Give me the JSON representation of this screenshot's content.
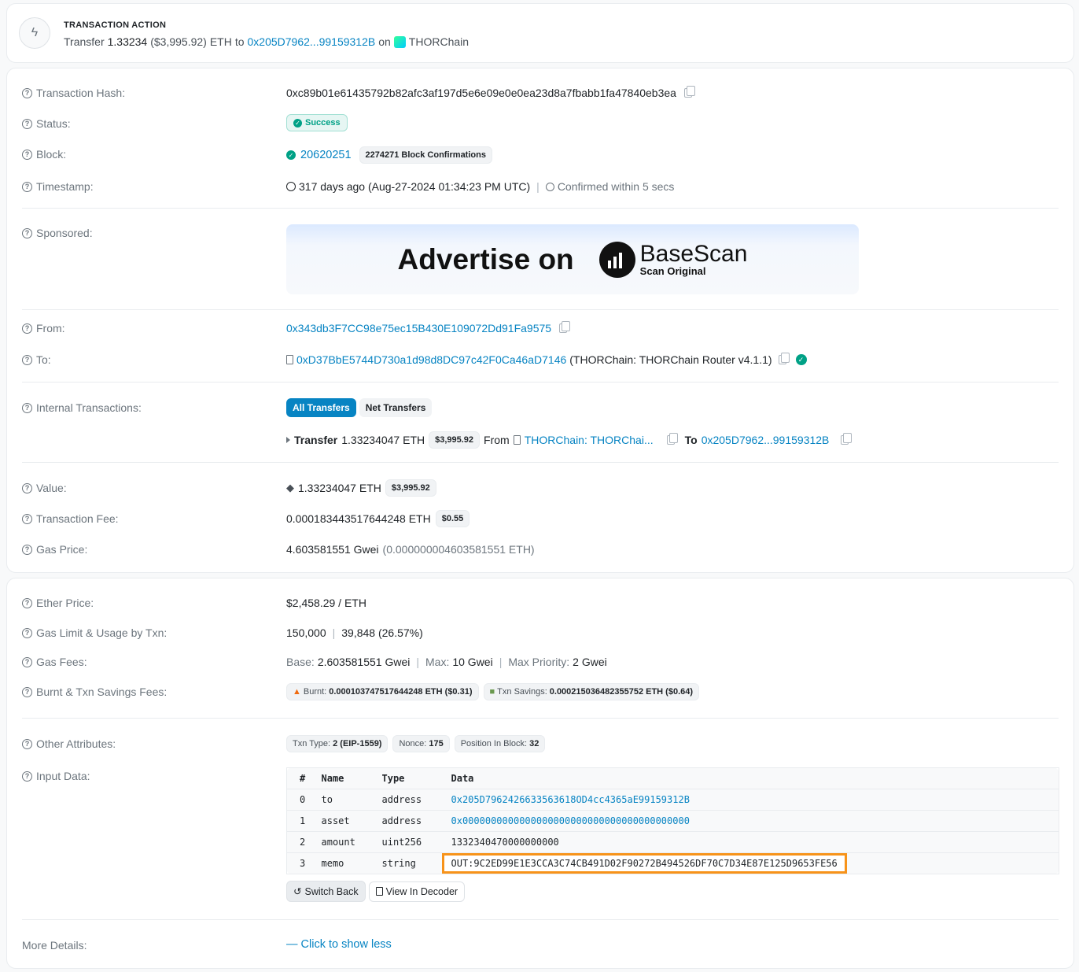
{
  "txn_action": {
    "title": "TRANSACTION ACTION",
    "verb": "Transfer",
    "amount": "1.33234",
    "usd": "($3,995.92)",
    "token": "ETH",
    "to_word": "to",
    "to_address": "0x205D7962...99159312B",
    "on_word": "on",
    "platform": "THORChain"
  },
  "overview": {
    "hash_label": "Transaction Hash:",
    "hash": "0xc89b01e61435792b82afc3af197d5e6e09e0e0ea23d8a7fbabb1fa47840eb3ea",
    "status_label": "Status:",
    "status": "Success",
    "block_label": "Block:",
    "block": "20620251",
    "confirmations": "2274271 Block Confirmations",
    "timestamp_label": "Timestamp:",
    "timestamp": "317 days ago (Aug-27-2024 01:34:23 PM UTC)",
    "confirmed": "Confirmed within 5 secs",
    "sponsored_label": "Sponsored:",
    "ad_text": "Advertise on",
    "ad_brand": "BaseScan",
    "ad_sub": "Scan Original",
    "from_label": "From:",
    "from": "0x343db3F7CC98e75ec15B430E109072Dd91Fa9575",
    "to_label": "To:",
    "to": "0xD37BbE5744D730a1d98d8DC97c42F0Ca46aD7146",
    "to_name": "(THORChain: THORChain Router v4.1.1)",
    "internal_label": "Internal Transactions:",
    "tab_all": "All Transfers",
    "tab_net": "Net Transfers",
    "it_transfer": "Transfer",
    "it_amount": "1.33234047 ETH",
    "it_usd": "$3,995.92",
    "it_from_word": "From",
    "it_from": "THORChain: THORChai...",
    "it_to_word": "To",
    "it_to": "0x205D7962...99159312B",
    "value_label": "Value:",
    "value": "1.33234047 ETH",
    "value_usd": "$3,995.92",
    "fee_label": "Transaction Fee:",
    "fee": "0.000183443517644248 ETH",
    "fee_usd": "$0.55",
    "gasprice_label": "Gas Price:",
    "gasprice": "4.603581551 Gwei",
    "gasprice_eth": "(0.000000004603581551 ETH)"
  },
  "more": {
    "ether_price_label": "Ether Price:",
    "ether_price": "$2,458.29 / ETH",
    "gas_limit_label": "Gas Limit & Usage by Txn:",
    "gas_limit": "150,000",
    "gas_used": "39,848 (26.57%)",
    "gas_fees_label": "Gas Fees:",
    "base_k": "Base:",
    "base_v": "2.603581551 Gwei",
    "max_k": "Max:",
    "max_v": "10 Gwei",
    "maxp_k": "Max Priority:",
    "maxp_v": "2 Gwei",
    "burnt_label": "Burnt & Txn Savings Fees:",
    "burnt_k": "Burnt:",
    "burnt_v": "0.000103747517644248 ETH ($0.31)",
    "savings_k": "Txn Savings:",
    "savings_v": "0.000215036482355752 ETH ($0.64)",
    "other_label": "Other Attributes:",
    "txn_type_k": "Txn Type:",
    "txn_type_v": "2 (EIP-1559)",
    "nonce_k": "Nonce:",
    "nonce_v": "175",
    "position_k": "Position In Block:",
    "position_v": "32",
    "input_label": "Input Data:",
    "input_headers": [
      "#",
      "Name",
      "Type",
      "Data"
    ],
    "input_rows": [
      {
        "idx": "0",
        "name": "to",
        "type": "address",
        "data": "0x205D7962426633563618OD4cc4365aE99159312B"
      },
      {
        "idx": "1",
        "name": "asset",
        "type": "address",
        "data": "0x0000000000000000000000000000000000000000"
      },
      {
        "idx": "2",
        "name": "amount",
        "type": "uint256",
        "data": "1332340470000000000"
      },
      {
        "idx": "3",
        "name": "memo",
        "type": "string",
        "data": "OUT:9C2ED99E1E3CCA3C74CB491D02F90272B494526DF70C7D34E87E125D9653FE56"
      }
    ],
    "switch_back": "Switch Back",
    "view_decoder": "View In Decoder",
    "more_details_label": "More Details:",
    "show_less": "— Click to show less"
  },
  "colors": {
    "link": "#0784c3",
    "success": "#00a186",
    "highlight": "#f7931a"
  }
}
